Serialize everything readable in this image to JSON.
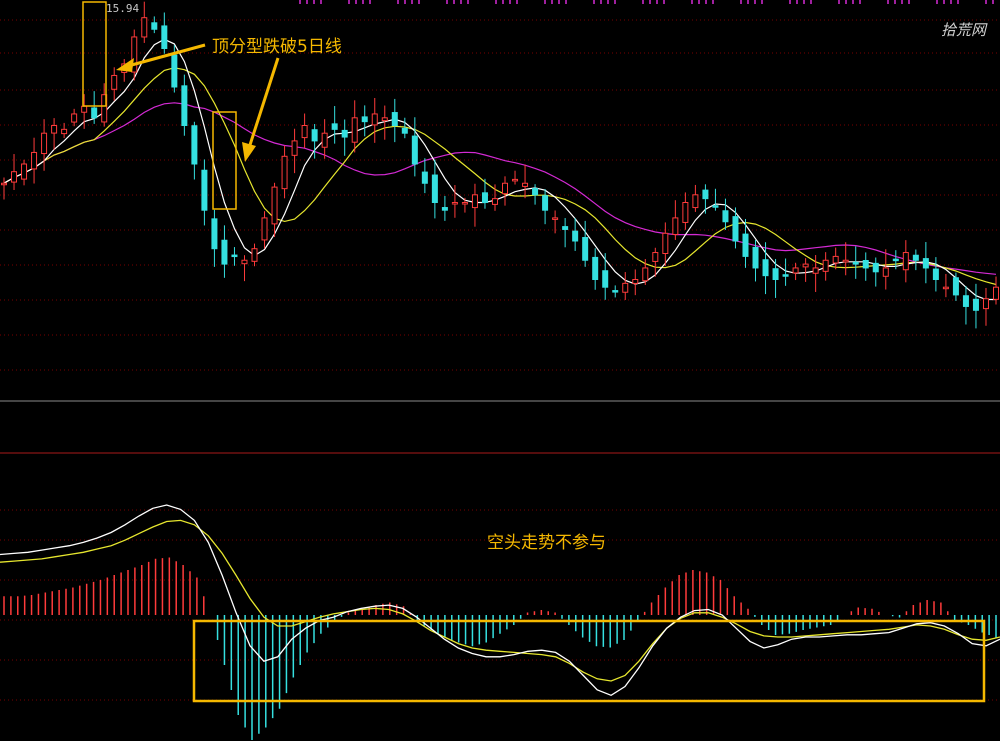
{
  "colors": {
    "up": "#ff3b3b",
    "down": "#35e0e0",
    "ma5": "#ffffff",
    "ma10": "#e6e62e",
    "ma20": "#d42ad4",
    "annotation": "#f5b800",
    "grid": "#7a0000"
  },
  "labels": {
    "high_price": "15.94",
    "annotation_top": "顶分型跌破5日线",
    "annotation_bottom": "空头走势不参与",
    "watermark": "拾荒网"
  },
  "chart_data": [
    {
      "type": "candlestick",
      "panel": "price",
      "max_price": 15.94,
      "shape": [
        0.55,
        0.58,
        0.6,
        0.63,
        0.68,
        0.7,
        0.69,
        0.73,
        0.75,
        0.72,
        0.78,
        0.83,
        0.86,
        0.93,
        0.98,
        0.95,
        0.9,
        0.8,
        0.7,
        0.6,
        0.48,
        0.38,
        0.34,
        0.36,
        0.35,
        0.38,
        0.46,
        0.54,
        0.62,
        0.66,
        0.7,
        0.66,
        0.68,
        0.69,
        0.67,
        0.72,
        0.71,
        0.73,
        0.72,
        0.7,
        0.68,
        0.6,
        0.55,
        0.5,
        0.48,
        0.5,
        0.5,
        0.52,
        0.5,
        0.51,
        0.55,
        0.56,
        0.55,
        0.52,
        0.48,
        0.46,
        0.43,
        0.4,
        0.35,
        0.3,
        0.28,
        0.27,
        0.29,
        0.3,
        0.33,
        0.37,
        0.42,
        0.46,
        0.5,
        0.52,
        0.51,
        0.49,
        0.45,
        0.4,
        0.36,
        0.33,
        0.31,
        0.3,
        0.31,
        0.33,
        0.34,
        0.33,
        0.35,
        0.36,
        0.35,
        0.34,
        0.33,
        0.32,
        0.33,
        0.35,
        0.37,
        0.35,
        0.33,
        0.3,
        0.28,
        0.26,
        0.23,
        0.22,
        0.25,
        0.28
      ],
      "series": [
        {
          "name": "",
          "key": "ma5"
        },
        {
          "name": "",
          "key": "ma10"
        },
        {
          "name": "",
          "key": "ma20"
        }
      ]
    },
    {
      "type": "macd",
      "panel": "indicator",
      "dif": [
        0.55,
        0.56,
        0.57,
        0.59,
        0.61,
        0.63,
        0.66,
        0.7,
        0.75,
        0.82,
        0.9,
        0.97,
        1.0,
        0.96,
        0.86,
        0.66,
        0.36,
        0.02,
        -0.28,
        -0.42,
        -0.38,
        -0.22,
        -0.12,
        -0.05,
        -0.02,
        0.03,
        0.06,
        0.08,
        0.09,
        0.06,
        -0.02,
        -0.12,
        -0.22,
        -0.3,
        -0.35,
        -0.38,
        -0.38,
        -0.36,
        -0.33,
        -0.32,
        -0.34,
        -0.42,
        -0.55,
        -0.68,
        -0.73,
        -0.65,
        -0.48,
        -0.28,
        -0.12,
        -0.02,
        0.04,
        0.05,
        0.0,
        -0.12,
        -0.24,
        -0.3,
        -0.27,
        -0.22,
        -0.2,
        -0.2,
        -0.19,
        -0.18,
        -0.18,
        -0.17,
        -0.16,
        -0.12,
        -0.08,
        -0.07,
        -0.1,
        -0.17,
        -0.26,
        -0.28,
        -0.22
      ],
      "dea": [
        0.48,
        0.49,
        0.5,
        0.51,
        0.53,
        0.55,
        0.57,
        0.6,
        0.63,
        0.68,
        0.74,
        0.8,
        0.85,
        0.86,
        0.82,
        0.72,
        0.56,
        0.36,
        0.15,
        -0.02,
        -0.1,
        -0.1,
        -0.06,
        -0.02,
        0.01,
        0.03,
        0.05,
        0.06,
        0.05,
        0.01,
        -0.06,
        -0.14,
        -0.2,
        -0.26,
        -0.3,
        -0.32,
        -0.33,
        -0.34,
        -0.35,
        -0.36,
        -0.38,
        -0.44,
        -0.52,
        -0.58,
        -0.6,
        -0.55,
        -0.42,
        -0.26,
        -0.12,
        -0.03,
        0.02,
        0.02,
        -0.02,
        -0.08,
        -0.15,
        -0.19,
        -0.2,
        -0.2,
        -0.19,
        -0.18,
        -0.17,
        -0.16,
        -0.15,
        -0.14,
        -0.13,
        -0.11,
        -0.09,
        -0.1,
        -0.13,
        -0.18,
        -0.22,
        -0.23,
        -0.2
      ],
      "histogram": [
        0.15,
        0.15,
        0.16,
        0.18,
        0.2,
        0.22,
        0.25,
        0.28,
        0.32,
        0.36,
        0.4,
        0.45,
        0.46,
        0.4,
        0.3,
        0.0,
        -0.4,
        -0.8,
        -1.0,
        -0.9,
        -0.75,
        -0.5,
        -0.3,
        -0.15,
        -0.05,
        0.02,
        0.05,
        0.08,
        0.1,
        0.07,
        -0.05,
        -0.12,
        -0.18,
        -0.22,
        -0.25,
        -0.22,
        -0.15,
        -0.08,
        0.02,
        0.04,
        0.02,
        -0.08,
        -0.18,
        -0.25,
        -0.26,
        -0.2,
        -0.05,
        0.1,
        0.22,
        0.32,
        0.36,
        0.34,
        0.28,
        0.15,
        0.05,
        -0.08,
        -0.16,
        -0.15,
        -0.12,
        -0.1,
        -0.08,
        0.0,
        0.06,
        0.05,
        0.0,
        -0.02,
        0.08,
        0.12,
        0.1,
        -0.04,
        -0.08,
        -0.14,
        -0.18
      ]
    }
  ]
}
